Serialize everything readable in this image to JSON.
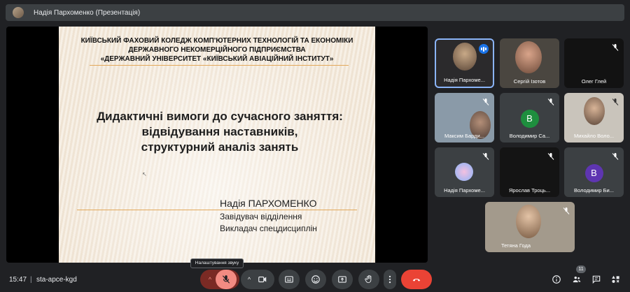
{
  "topbar": {
    "presenter_label": "Надія Пархоменко (Презентація)"
  },
  "slide": {
    "header_line1": "КИЇВСЬКИЙ ФАХОВИЙ КОЛЕДЖ КОМП'ЮТЕРНИХ ТЕХНОЛОГІЙ ТА ЕКОНОМІКИ",
    "header_line2": "ДЕРЖАВНОГО НЕКОМЕРЦІЙНОГО ПІДПРИЄМСТВА",
    "header_line3": "«ДЕРЖАВНИЙ УНІВЕРСИТЕТ «КИЇВСЬКИЙ АВІАЦІЙНИЙ ІНСТИТУТ»",
    "title_line1": "Дидактичні вимоги до сучасного заняття:",
    "title_line2": "відвідування наставників,",
    "title_line3": "структурний аналіз занять",
    "author": "Надія ПАРХОМЕНКО",
    "role1": "Завідувач відділення",
    "role2": "Викладач спецдисциплін"
  },
  "participants": [
    {
      "name": "Надія Пархоме...",
      "type": "video",
      "muted": false,
      "speaking": true
    },
    {
      "name": "Сергій Ізотов",
      "type": "video",
      "muted": false
    },
    {
      "name": "Олег Глей",
      "type": "video",
      "muted": true
    },
    {
      "name": "Максим Барди...",
      "type": "video",
      "muted": true
    },
    {
      "name": "Володимир Са...",
      "type": "avatar",
      "letter": "В",
      "color": "#1e8e3e",
      "muted": true
    },
    {
      "name": "Михайло Воло...",
      "type": "video",
      "muted": true
    },
    {
      "name": "Надія Пархоме...",
      "type": "image",
      "muted": true
    },
    {
      "name": "Ярослав Троць...",
      "type": "video",
      "muted": true
    },
    {
      "name": "Володимир Би...",
      "type": "avatar",
      "letter": "В",
      "color": "#5e35b1",
      "muted": true
    },
    {
      "name": "Тетяна Года",
      "type": "video",
      "muted": true
    }
  ],
  "bottombar": {
    "time": "15:47",
    "separator": "|",
    "meeting_code": "sta-apce-kgd",
    "tooltip": "Налаштування звуку",
    "participants_count": "11"
  },
  "colors": {
    "end_call": "#ea4335",
    "mic_off": "#f28b82",
    "accent": "#8ab4f8"
  }
}
